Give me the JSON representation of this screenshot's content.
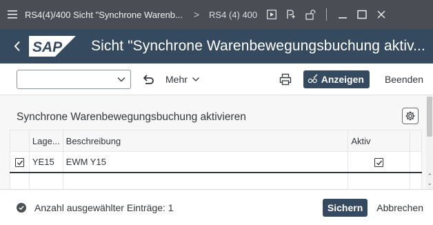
{
  "window": {
    "title": "RS4(4)/400 Sicht \"Synchrone Warenb...",
    "separator": ">",
    "subtitle": "RS4 (4) 400"
  },
  "header": {
    "logo_text": "SAP",
    "title": "Sicht \"Synchrone Warenbewegungsbuchung aktiv..."
  },
  "toolbar": {
    "combo_value": "",
    "more_label": "Mehr",
    "display_label": "Anzeigen",
    "exit_label": "Beenden"
  },
  "panel": {
    "title": "Synchrone Warenbewegungsbuchung aktivieren"
  },
  "table": {
    "columns": [
      "Lage...",
      "Beschreibung",
      "Aktiv"
    ],
    "rows": [
      {
        "selected": true,
        "lagerort": "YE15",
        "beschreibung": "EWM Y15",
        "aktiv": true
      },
      {
        "selected": false,
        "lagerort": "",
        "beschreibung": "",
        "aktiv": false
      }
    ]
  },
  "footer": {
    "status_text": "Anzahl ausgewählter Einträge: 1",
    "save_label": "Sichern",
    "cancel_label": "Abbrechen"
  },
  "colors": {
    "titlebar": "#4a4e54",
    "shell": "#354a5f",
    "emphasized_button": "#354a5f",
    "content_bg": "#f7f7f7"
  }
}
